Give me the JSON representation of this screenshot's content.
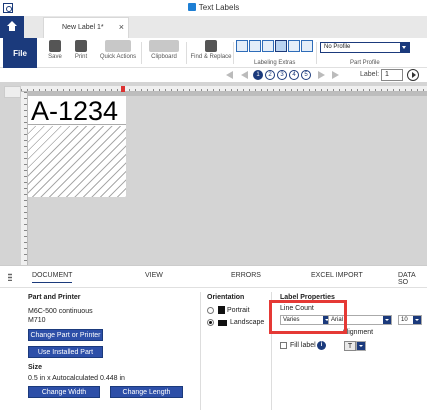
{
  "window": {
    "title": "Text Labels"
  },
  "tabs": {
    "document_tab": "New Label 1*",
    "close_glyph": "×"
  },
  "ribbon": {
    "file": "File",
    "save": "Save",
    "print": "Print",
    "quick_actions": "Quick Actions",
    "clipboard": "Clipboard",
    "find_replace": "Find & Replace",
    "labeling_extras": "Labeling Extras",
    "profile_value": "No Profile",
    "part_profile": "Part Profile"
  },
  "nav": {
    "pages": [
      "1",
      "2",
      "3",
      "4",
      "5"
    ],
    "label_caption": "Label:",
    "label_value": "1"
  },
  "canvas": {
    "label_text": "A-1234"
  },
  "panel_tabs": [
    "DOCUMENT",
    "VIEW",
    "ERRORS",
    "EXCEL IMPORT",
    "DATA SO"
  ],
  "document": {
    "part_printer_title": "Part and Printer",
    "part_name": "M6C-500 continuous",
    "printer": "M710",
    "change_part_btn": "Change Part or Printer",
    "use_installed_btn": "Use Installed Part",
    "size_title": "Size",
    "size_value": "0.5 in x Autocalculated 0.448 in",
    "change_width_btn": "Change Width",
    "change_length_btn": "Change Length",
    "orientation_title": "Orientation",
    "portrait": "Portrait",
    "landscape": "Landscape",
    "label_props_title": "Label Properties",
    "line_count_label": "Line Count",
    "line_count_value": "Varies",
    "font_value": "Arial",
    "font_size_value": "10",
    "fill_label": "Fill label",
    "alignment_label": "Alignment",
    "alignment_value": "T",
    "info_glyph": "i"
  }
}
